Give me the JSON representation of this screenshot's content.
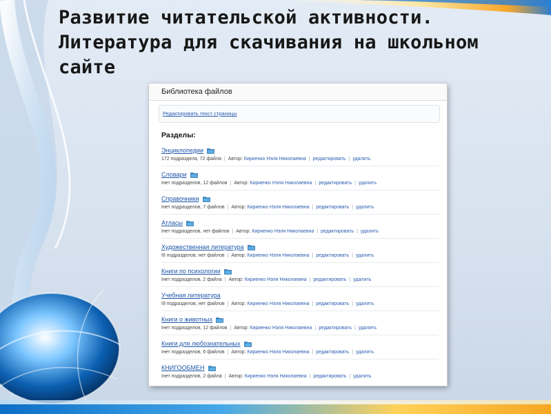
{
  "slide": {
    "title_lines": [
      "Развитие читательской активности.",
      "Литература для скачивания на школьном",
      "сайте"
    ]
  },
  "screenshot": {
    "header_title": "Библиотека файлов",
    "edit_page_link": "Редактировать текст страницы",
    "sections_label": "Разделы:",
    "author_label": "Автор:",
    "edit_label": "редактировать",
    "delete_label": "удалить",
    "folders": [
      {
        "name": "Энциклопедии",
        "info": "172 подраздела, 72 файла",
        "author": "Кириенко Нэля Николаевна",
        "icon": "folder-icon"
      },
      {
        "name": "Словари",
        "info": "Інет подразделов, 12 файлов",
        "author": "Кириенко Нэля Николаевна",
        "icon": "folder-icon"
      },
      {
        "name": "Справочники",
        "info": "Інет подразделов, 7 файлов",
        "author": "Кириенко Нэля Николаевна",
        "icon": "folder-icon"
      },
      {
        "name": "Атласы",
        "info": "Інет подразделов, нет файлов",
        "author": "Кириенко Нэля Николаевна",
        "icon": "folder-icon"
      },
      {
        "name": "Художественная литература",
        "info": "І6 подразделов, нет файлов",
        "author": "Кириенко Нэля Николаевна",
        "icon": "folder-icon"
      },
      {
        "name": "Книги по психологии",
        "info": "Інет подразделов, 2 файла",
        "author": "Кириенко Нэля Николаевна",
        "icon": "folder-icon"
      },
      {
        "name": "Учебная литература",
        "info": "І9 подразделов, нет файлов",
        "author": "Кириенко Нэля Николаевна",
        "icon": ""
      },
      {
        "name": "Книги о животных",
        "info": "Інет подразделов, 12 файлов",
        "author": "Кириенко Нэля Николаевна",
        "icon": "folder-icon"
      },
      {
        "name": "Книги для любознательных",
        "info": "Інет подразделов, 6 файлов",
        "author": "Кириенко Нэля Николаевна",
        "icon": "folder-icon"
      },
      {
        "name": "КНИГООБМЕН",
        "info": "Інет подразделов, 2 файла",
        "author": "Кириенко Нэля Николаевна",
        "icon": "folder-icon"
      }
    ]
  },
  "colors": {
    "link": "#1c56a8",
    "accent_blue": "#0b6fc7",
    "accent_orange": "#f6a623"
  }
}
